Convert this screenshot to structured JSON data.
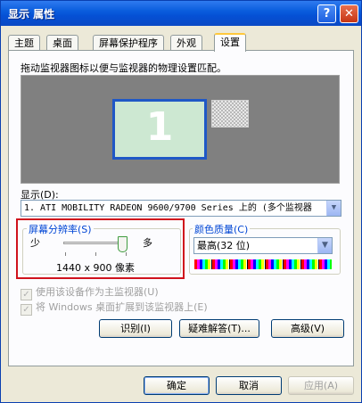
{
  "window": {
    "title": "显示 属性",
    "help_label": "?",
    "close_label": "✕"
  },
  "tabs": [
    "主题",
    "桌面",
    "屏幕保护程序",
    "外观",
    "设置"
  ],
  "active_tab": "设置",
  "settings": {
    "instruction": "拖动监视器图标以便与监视器的物理设置匹配。",
    "monitor1_number": "1",
    "display_label": "显示(D):",
    "display_value": "1. ATI MOBILITY RADEON 9600/9700 Series 上的 (多个监视器",
    "resolution": {
      "label": "屏幕分辨率(S)",
      "min_label": "少",
      "max_label": "多",
      "value": "1440 x 900 像素",
      "slider_level": 1.0
    },
    "color_quality": {
      "label": "颜色质量(C)",
      "value": "最高(32 位)"
    },
    "checkbox_primary": {
      "label": "使用该设备作为主监视器(U)",
      "checked": true,
      "enabled": false
    },
    "checkbox_extend": {
      "label": "将 Windows 桌面扩展到该监视器上(E)",
      "checked": true,
      "enabled": false
    },
    "buttons": {
      "identify": "识别(I)",
      "troubleshoot": "疑难解答(T)...",
      "advanced": "高级(V)"
    }
  },
  "footer": {
    "ok": "确定",
    "cancel": "取消",
    "apply": "应用(A)"
  },
  "colors": {
    "title_bar": "#0a5ddd",
    "highlight_box": "#d0121c",
    "tab_accent": "#ffc83c"
  }
}
